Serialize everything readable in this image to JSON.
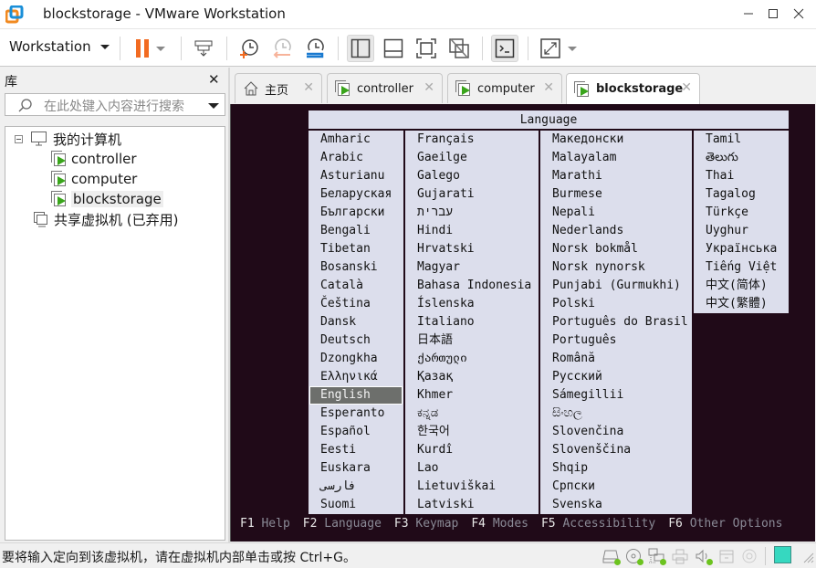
{
  "window": {
    "title": "blockstorage - VMware Workstation",
    "minimize_label": "—",
    "maximize_label": "☐",
    "close_label": "✕"
  },
  "toolbar": {
    "menu_label": "Workstation",
    "buttons": [
      "pause-vm",
      "send-ctrl-alt-del",
      "take-snapshot",
      "revert-snapshot",
      "manage-snapshots",
      "show-library",
      "show-thumbnail-bar",
      "full-screen",
      "unity",
      "console-view",
      "stretch-guest"
    ]
  },
  "sidebar": {
    "title": "库",
    "close_label": "✕",
    "search_placeholder": "在此处键入内容进行搜索",
    "tree": {
      "root_label": "我的计算机",
      "vms": [
        {
          "label": "controller"
        },
        {
          "label": "computer"
        },
        {
          "label": "blockstorage",
          "selected": true
        }
      ],
      "shared_label": "共享虚拟机 (已弃用)"
    }
  },
  "tabs": [
    {
      "label": "主页",
      "icon": "home-icon"
    },
    {
      "label": "controller",
      "icon": "vm-icon"
    },
    {
      "label": "computer",
      "icon": "vm-icon"
    },
    {
      "label": "blockstorage",
      "icon": "vm-icon",
      "active": true
    }
  ],
  "installer": {
    "header": "Language",
    "columns": [
      [
        "Amharic",
        "Arabic",
        "Asturianu",
        "Беларуская",
        "Български",
        "Bengali",
        "Tibetan",
        "Bosanski",
        "Català",
        "Čeština",
        "Dansk",
        "Deutsch",
        "Dzongkha",
        "Ελληνικά",
        "English",
        "Esperanto",
        "Español",
        "Eesti",
        "Euskara",
        "فارسی",
        "Suomi"
      ],
      [
        "Français",
        "Gaeilge",
        "Galego",
        "Gujarati",
        "עברית",
        "Hindi",
        "Hrvatski",
        "Magyar",
        "Bahasa Indonesia",
        "Íslenska",
        "Italiano",
        "日本語",
        "ქართული",
        "Қазақ",
        "Khmer",
        "ಕನ್ನಡ",
        "한국어",
        "Kurdî",
        "Lao",
        "Lietuviškai",
        "Latviski"
      ],
      [
        "Македонски",
        "Malayalam",
        "Marathi",
        "Burmese",
        "Nepali",
        "Nederlands",
        "Norsk bokmål",
        "Norsk nynorsk",
        "Punjabi (Gurmukhi)",
        "Polski",
        "Português do Brasil",
        "Português",
        "Română",
        "Русский",
        "Sámegillii",
        "සිංහල",
        "Slovenčina",
        "Slovenščina",
        "Shqip",
        "Српски",
        "Svenska"
      ],
      [
        "Tamil",
        "తెలుగు",
        "Thai",
        "Tagalog",
        "Türkçe",
        "Uyghur",
        "Українська",
        "Tiếng Việt",
        "中文(简体)",
        "中文(繁體)"
      ]
    ],
    "selected": "English",
    "function_keys": [
      {
        "key": "F1",
        "label": "Help"
      },
      {
        "key": "F2",
        "label": "Language"
      },
      {
        "key": "F3",
        "label": "Keymap"
      },
      {
        "key": "F4",
        "label": "Modes"
      },
      {
        "key": "F5",
        "label": "Accessibility"
      },
      {
        "key": "F6",
        "label": "Other Options"
      }
    ]
  },
  "statusbar": {
    "message": "要将输入定向到该虚拟机，请在虚拟机内部单击或按 Ctrl+G。",
    "devices": [
      "hard-disk",
      "cd-dvd",
      "network-adapter",
      "printer",
      "sound-card",
      "usb-controller",
      "camera"
    ]
  },
  "colors": {
    "vm_background": "#200a18",
    "menu_background": "#dcdeec",
    "selection": "#6d6f6c",
    "pause_orange": "#f26b21",
    "active_dot": "#6cc31f",
    "note": "#36d8c0"
  }
}
